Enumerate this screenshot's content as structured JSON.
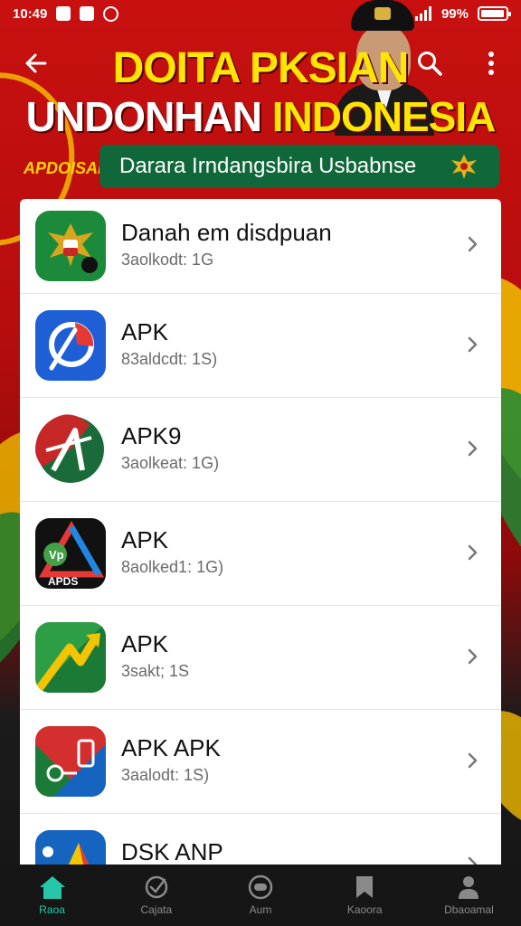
{
  "status_bar": {
    "time": "10:49",
    "battery": "99%"
  },
  "header": {
    "title_line1": "DOITA PKSIAN",
    "title_line2_part1": "UNDONHAN",
    "title_line2_part2": "INDONESIA",
    "side_label": "APDOISAF",
    "banner_text": "Darara Irndangsbira Usbabnse"
  },
  "apps": [
    {
      "name": "Danah em disdpuan",
      "meta": "3aolkodt: 1G"
    },
    {
      "name": "APK",
      "meta": "83aldcdt: 1S)"
    },
    {
      "name": "APK9",
      "meta": "3aolkeat: 1G)"
    },
    {
      "name": "APK",
      "meta": "8aolked1: 1G)"
    },
    {
      "name": "APK",
      "meta": "3sakt; 1S"
    },
    {
      "name": "APK APK",
      "meta": "3aalodt: 1S)"
    },
    {
      "name": "DSK ANP",
      "meta": ""
    }
  ],
  "bottom_nav": [
    {
      "label": "Raoa",
      "icon": "home-icon",
      "active": true
    },
    {
      "label": "Cajata",
      "icon": "apps-icon",
      "active": false
    },
    {
      "label": "Aum",
      "icon": "chat-icon",
      "active": false
    },
    {
      "label": "Kaoora",
      "icon": "bookmark-icon",
      "active": false
    },
    {
      "label": "Dbaoamal",
      "icon": "profile-icon",
      "active": false
    }
  ],
  "colors": {
    "header_red": "#c81010",
    "title_yellow": "#ffe500",
    "banner_green": "#10683a",
    "nav_active": "#26c6a8"
  }
}
